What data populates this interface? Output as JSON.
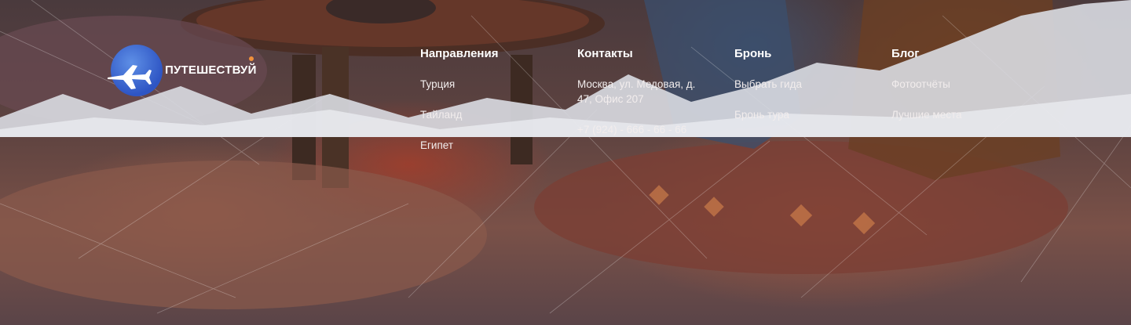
{
  "logo": {
    "text": "ПУТЕШЕСТВУЙ",
    "alt": "globe-plane-logo"
  },
  "columns": [
    {
      "title": "Направления",
      "items": [
        "Турция",
        "Тайланд",
        "Египет"
      ]
    },
    {
      "title": "Контакты",
      "items": [
        "Москва, ул. Медовая, д. 47, Офис 207",
        "+7 (924) - 666 - 66 - 66"
      ]
    },
    {
      "title": "Бронь",
      "items": [
        "Выбрать гида",
        "Бронь тура"
      ]
    },
    {
      "title": "Блог",
      "items": [
        "Фотоотчёты",
        "Лучшие места"
      ]
    }
  ],
  "colors": {
    "accent": "#f1913b",
    "logo_blue": "#2e55c4",
    "mountains": "#d9dbe2"
  }
}
